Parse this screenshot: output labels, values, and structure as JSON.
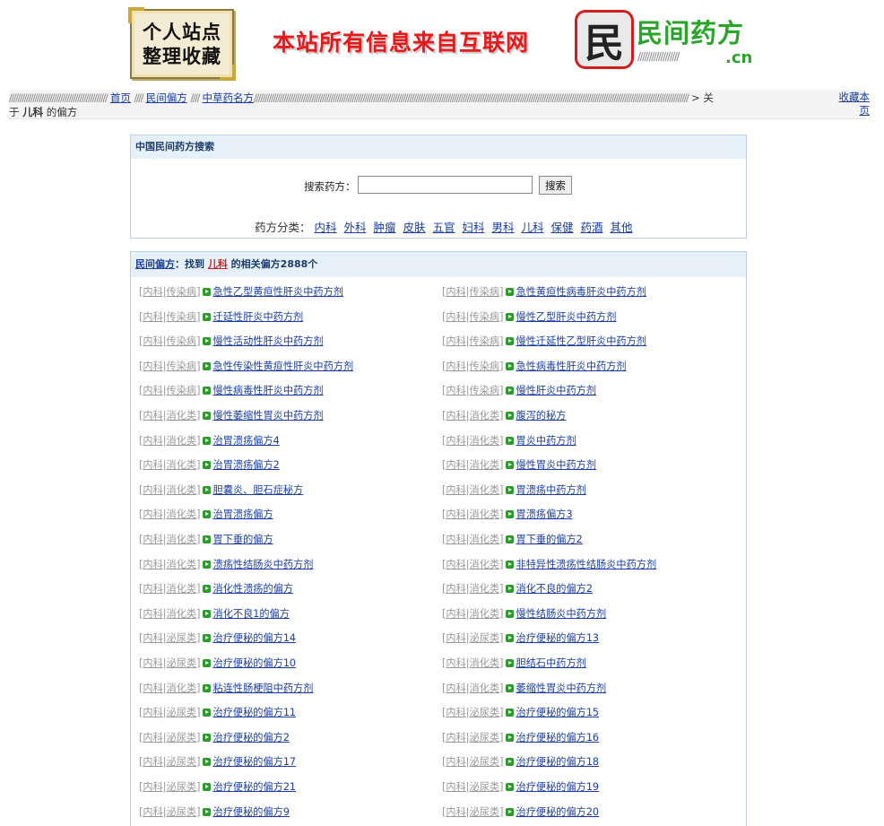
{
  "header": {
    "logo_left_line1": "个人站点",
    "logo_left_line2": "整理收藏",
    "banner": "本站所有信息来自互联网",
    "logo_right_glyph": "民",
    "logo_right_text": "民间药方",
    "logo_right_domain": ".cn"
  },
  "breadcrumb": {
    "home": "首页",
    "folk": "民间偏方",
    "herbal": "中草药名方",
    "separator": "////",
    "tail_prefix": "> 关",
    "tail_line2_a": "于 ",
    "tail_keyword": "儿科",
    "tail_line2_b": " 的偏方",
    "favorite": "收藏本页"
  },
  "search": {
    "panel_title": "中国民间药方搜索",
    "label": "搜索药方：",
    "input_value": "",
    "button": "搜索",
    "category_label": "药方分类：",
    "categories": [
      "内科",
      "外科",
      "肿瘤",
      "皮肤",
      "五官",
      "妇科",
      "男科",
      "儿科",
      "保健",
      "药酒",
      "其他"
    ]
  },
  "results": {
    "head_link": "民间偏方",
    "head_text1": "：找到 ",
    "keyword": "儿科",
    "head_text2": " 的相关偏方2888个",
    "items": [
      {
        "cat1": "内科",
        "cat2": "传染病",
        "title": "急性乙型黄疸性肝炎中药方剂"
      },
      {
        "cat1": "内科",
        "cat2": "传染病",
        "title": "急性黄疸性病毒肝炎中药方剂"
      },
      {
        "cat1": "内科",
        "cat2": "传染病",
        "title": "迁延性肝炎中药方剂"
      },
      {
        "cat1": "内科",
        "cat2": "传染病",
        "title": "慢性乙型肝炎中药方剂"
      },
      {
        "cat1": "内科",
        "cat2": "传染病",
        "title": "慢性活动性肝炎中药方剂"
      },
      {
        "cat1": "内科",
        "cat2": "传染病",
        "title": "慢性迁延性乙型肝炎中药方剂"
      },
      {
        "cat1": "内科",
        "cat2": "传染病",
        "title": "急性传染性黄疸性肝炎中药方剂"
      },
      {
        "cat1": "内科",
        "cat2": "传染病",
        "title": "急性病毒性肝炎中药方剂"
      },
      {
        "cat1": "内科",
        "cat2": "传染病",
        "title": "慢性病毒性肝炎中药方剂"
      },
      {
        "cat1": "内科",
        "cat2": "传染病",
        "title": "慢性肝炎中药方剂"
      },
      {
        "cat1": "内科",
        "cat2": "消化类",
        "title": "慢性萎缩性胃炎中药方剂"
      },
      {
        "cat1": "内科",
        "cat2": "消化类",
        "title": "腹泻的秘方"
      },
      {
        "cat1": "内科",
        "cat2": "消化类",
        "title": "治胃溃疡偏方4"
      },
      {
        "cat1": "内科",
        "cat2": "消化类",
        "title": "胃炎中药方剂"
      },
      {
        "cat1": "内科",
        "cat2": "消化类",
        "title": "治胃溃疡偏方2"
      },
      {
        "cat1": "内科",
        "cat2": "消化类",
        "title": "慢性胃炎中药方剂"
      },
      {
        "cat1": "内科",
        "cat2": "消化类",
        "title": "胆囊炎、胆石症秘方"
      },
      {
        "cat1": "内科",
        "cat2": "消化类",
        "title": "胃溃疡中药方剂"
      },
      {
        "cat1": "内科",
        "cat2": "消化类",
        "title": "治胃溃疡偏方"
      },
      {
        "cat1": "内科",
        "cat2": "消化类",
        "title": "胃溃疡偏方3"
      },
      {
        "cat1": "内科",
        "cat2": "消化类",
        "title": "胃下垂的偏方"
      },
      {
        "cat1": "内科",
        "cat2": "消化类",
        "title": "胃下垂的偏方2"
      },
      {
        "cat1": "内科",
        "cat2": "消化类",
        "title": "溃疡性结肠炎中药方剂"
      },
      {
        "cat1": "内科",
        "cat2": "消化类",
        "title": "非特异性溃疡性结肠炎中药方剂"
      },
      {
        "cat1": "内科",
        "cat2": "消化类",
        "title": "消化性溃疡的偏方"
      },
      {
        "cat1": "内科",
        "cat2": "消化类",
        "title": "消化不良的偏方2"
      },
      {
        "cat1": "内科",
        "cat2": "消化类",
        "title": "消化不良1的偏方"
      },
      {
        "cat1": "内科",
        "cat2": "消化类",
        "title": "慢性结肠炎中药方剂"
      },
      {
        "cat1": "内科",
        "cat2": "泌尿类",
        "title": "治疗便秘的偏方14"
      },
      {
        "cat1": "内科",
        "cat2": "泌尿类",
        "title": "治疗便秘的偏方13"
      },
      {
        "cat1": "内科",
        "cat2": "泌尿类",
        "title": "治疗便秘的偏方10"
      },
      {
        "cat1": "内科",
        "cat2": "消化类",
        "title": "胆结石中药方剂"
      },
      {
        "cat1": "内科",
        "cat2": "消化类",
        "title": "粘连性肠梗阻中药方剂"
      },
      {
        "cat1": "内科",
        "cat2": "消化类",
        "title": "萎缩性胃炎中药方剂"
      },
      {
        "cat1": "内科",
        "cat2": "泌尿类",
        "title": "治疗便秘的偏方11"
      },
      {
        "cat1": "内科",
        "cat2": "泌尿类",
        "title": "治疗便秘的偏方15"
      },
      {
        "cat1": "内科",
        "cat2": "泌尿类",
        "title": "治疗便秘的偏方2"
      },
      {
        "cat1": "内科",
        "cat2": "泌尿类",
        "title": "治疗便秘的偏方16"
      },
      {
        "cat1": "内科",
        "cat2": "泌尿类",
        "title": "治疗便秘的偏方17"
      },
      {
        "cat1": "内科",
        "cat2": "泌尿类",
        "title": "治疗便秘的偏方18"
      },
      {
        "cat1": "内科",
        "cat2": "泌尿类",
        "title": "治疗便秘的偏方21"
      },
      {
        "cat1": "内科",
        "cat2": "泌尿类",
        "title": "治疗便秘的偏方19"
      },
      {
        "cat1": "内科",
        "cat2": "泌尿类",
        "title": "治疗便秘的偏方9"
      },
      {
        "cat1": "内科",
        "cat2": "泌尿类",
        "title": "治疗便秘的偏方20"
      }
    ]
  }
}
